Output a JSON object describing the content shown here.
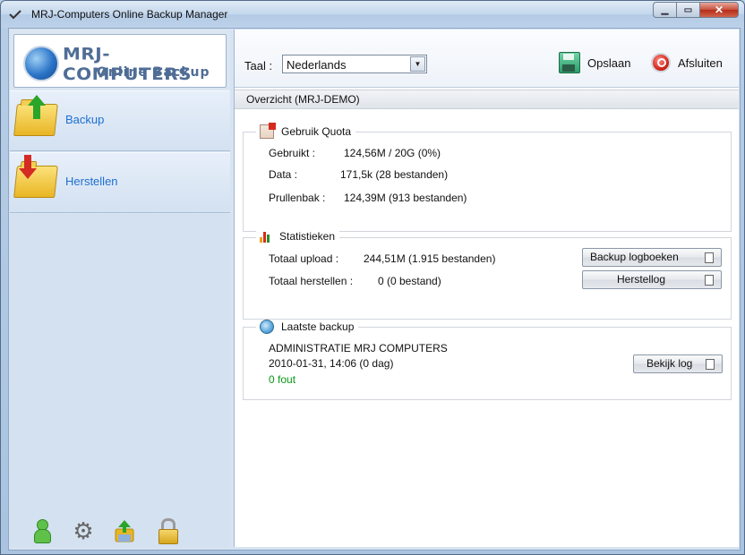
{
  "window": {
    "title": "MRJ-Computers Online Backup Manager"
  },
  "logo": {
    "line1": "MRJ-COMPUTERS",
    "line2": "Online Backup"
  },
  "sidebar": {
    "items": [
      {
        "label": "Backup",
        "icon": "folder-upload-icon"
      },
      {
        "label": "Herstellen",
        "icon": "folder-download-icon"
      }
    ],
    "bottom_icons": [
      "user-icon",
      "gear-icon",
      "upload-icon",
      "lock-icon"
    ]
  },
  "toolbar": {
    "language_label": "Taal :",
    "language_value": "Nederlands",
    "save_label": "Opslaan",
    "exit_label": "Afsluiten"
  },
  "overview": {
    "header": "Overzicht (MRJ-DEMO)",
    "quota": {
      "title": "Gebruik Quota",
      "rows": [
        {
          "label": "Gebruikt :",
          "value": "124,56M / 20G (0%)"
        },
        {
          "label": "Data :",
          "value": "171,5k  (28 bestanden)"
        },
        {
          "label": "Prullenbak :",
          "value": "124,39M  (913 bestanden)"
        }
      ]
    },
    "statistics": {
      "title": "Statistieken",
      "rows": [
        {
          "label": "Totaal upload :",
          "value": "244,51M  (1.915 bestanden)"
        },
        {
          "label": "Totaal herstellen :",
          "value": "0  (0 bestand)"
        }
      ],
      "backup_log_button": "Backup logboeken",
      "restore_log_button": "Herstellog"
    },
    "last_backup": {
      "title": "Laatste backup",
      "name": "ADMINISTRATIE MRJ COMPUTERS",
      "datetime": "2010-01-31, 14:06 (0 dag)",
      "errors": "0 fout",
      "view_log_button": "Bekijk log"
    }
  },
  "colors": {
    "link_blue": "#1d6fcf",
    "ok_green": "#0a9a15",
    "close_red": "#c7503b"
  }
}
